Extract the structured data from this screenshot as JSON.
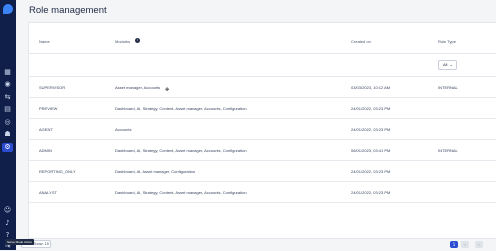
{
  "page": {
    "title": "Role management"
  },
  "table": {
    "headers": {
      "name": "Name",
      "modules": "Modules",
      "created_on": "Created on",
      "role_type": "Role Type"
    },
    "role_filter": {
      "value": "All"
    },
    "rows": [
      {
        "name": "SUPERVISOR",
        "modules": "Asset manager, Accounts",
        "created_on": "03/03/2023, 10:12 AM",
        "role_type": "INTERNAL"
      },
      {
        "name": "PREVIEW",
        "modules": "Dashboard, AI, Strategy, Content, Asset manager, Accounts, Configuration",
        "created_on": "24/01/2022, 03:23 PM",
        "role_type": ""
      },
      {
        "name": "AGENT",
        "modules": "Accounts",
        "created_on": "24/01/2022, 03:23 PM",
        "role_type": ""
      },
      {
        "name": "ADMIN",
        "modules": "Dashboard, AI, Strategy, Content, Asset manager, Accounts, Configuration",
        "created_on": "06/01/2023, 03:41 PM",
        "role_type": "INTERNAL"
      },
      {
        "name": "REPORTING_ONLY",
        "modules": "Dashboard, AI, Asset manager, Configuration",
        "created_on": "24/01/2022, 03:23 PM",
        "role_type": ""
      },
      {
        "name": "ANALYST",
        "modules": "Dashboard, AI, Strategy, Content, Asset manager, Accounts, Configuration",
        "created_on": "24/01/2022, 03:23 PM",
        "role_type": ""
      }
    ]
  },
  "footer": {
    "show_label": "Show: 15",
    "tooltip": "Serve Mode Active",
    "pagination": {
      "current": "1",
      "prev": "‹",
      "next": "›"
    }
  },
  "sidebar": {
    "icons": [
      "home-icon",
      "globe-icon",
      "strategy-icon",
      "content-icon",
      "asset-icon",
      "users-icon",
      "settings-icon"
    ],
    "bottom_icons": [
      "profile-icon",
      "bell-icon",
      "help-icon",
      "logout-icon"
    ]
  },
  "colors": {
    "sidebar": "#0f1f4a",
    "accent": "#2b4bd1",
    "background": "#f4f5f7"
  }
}
